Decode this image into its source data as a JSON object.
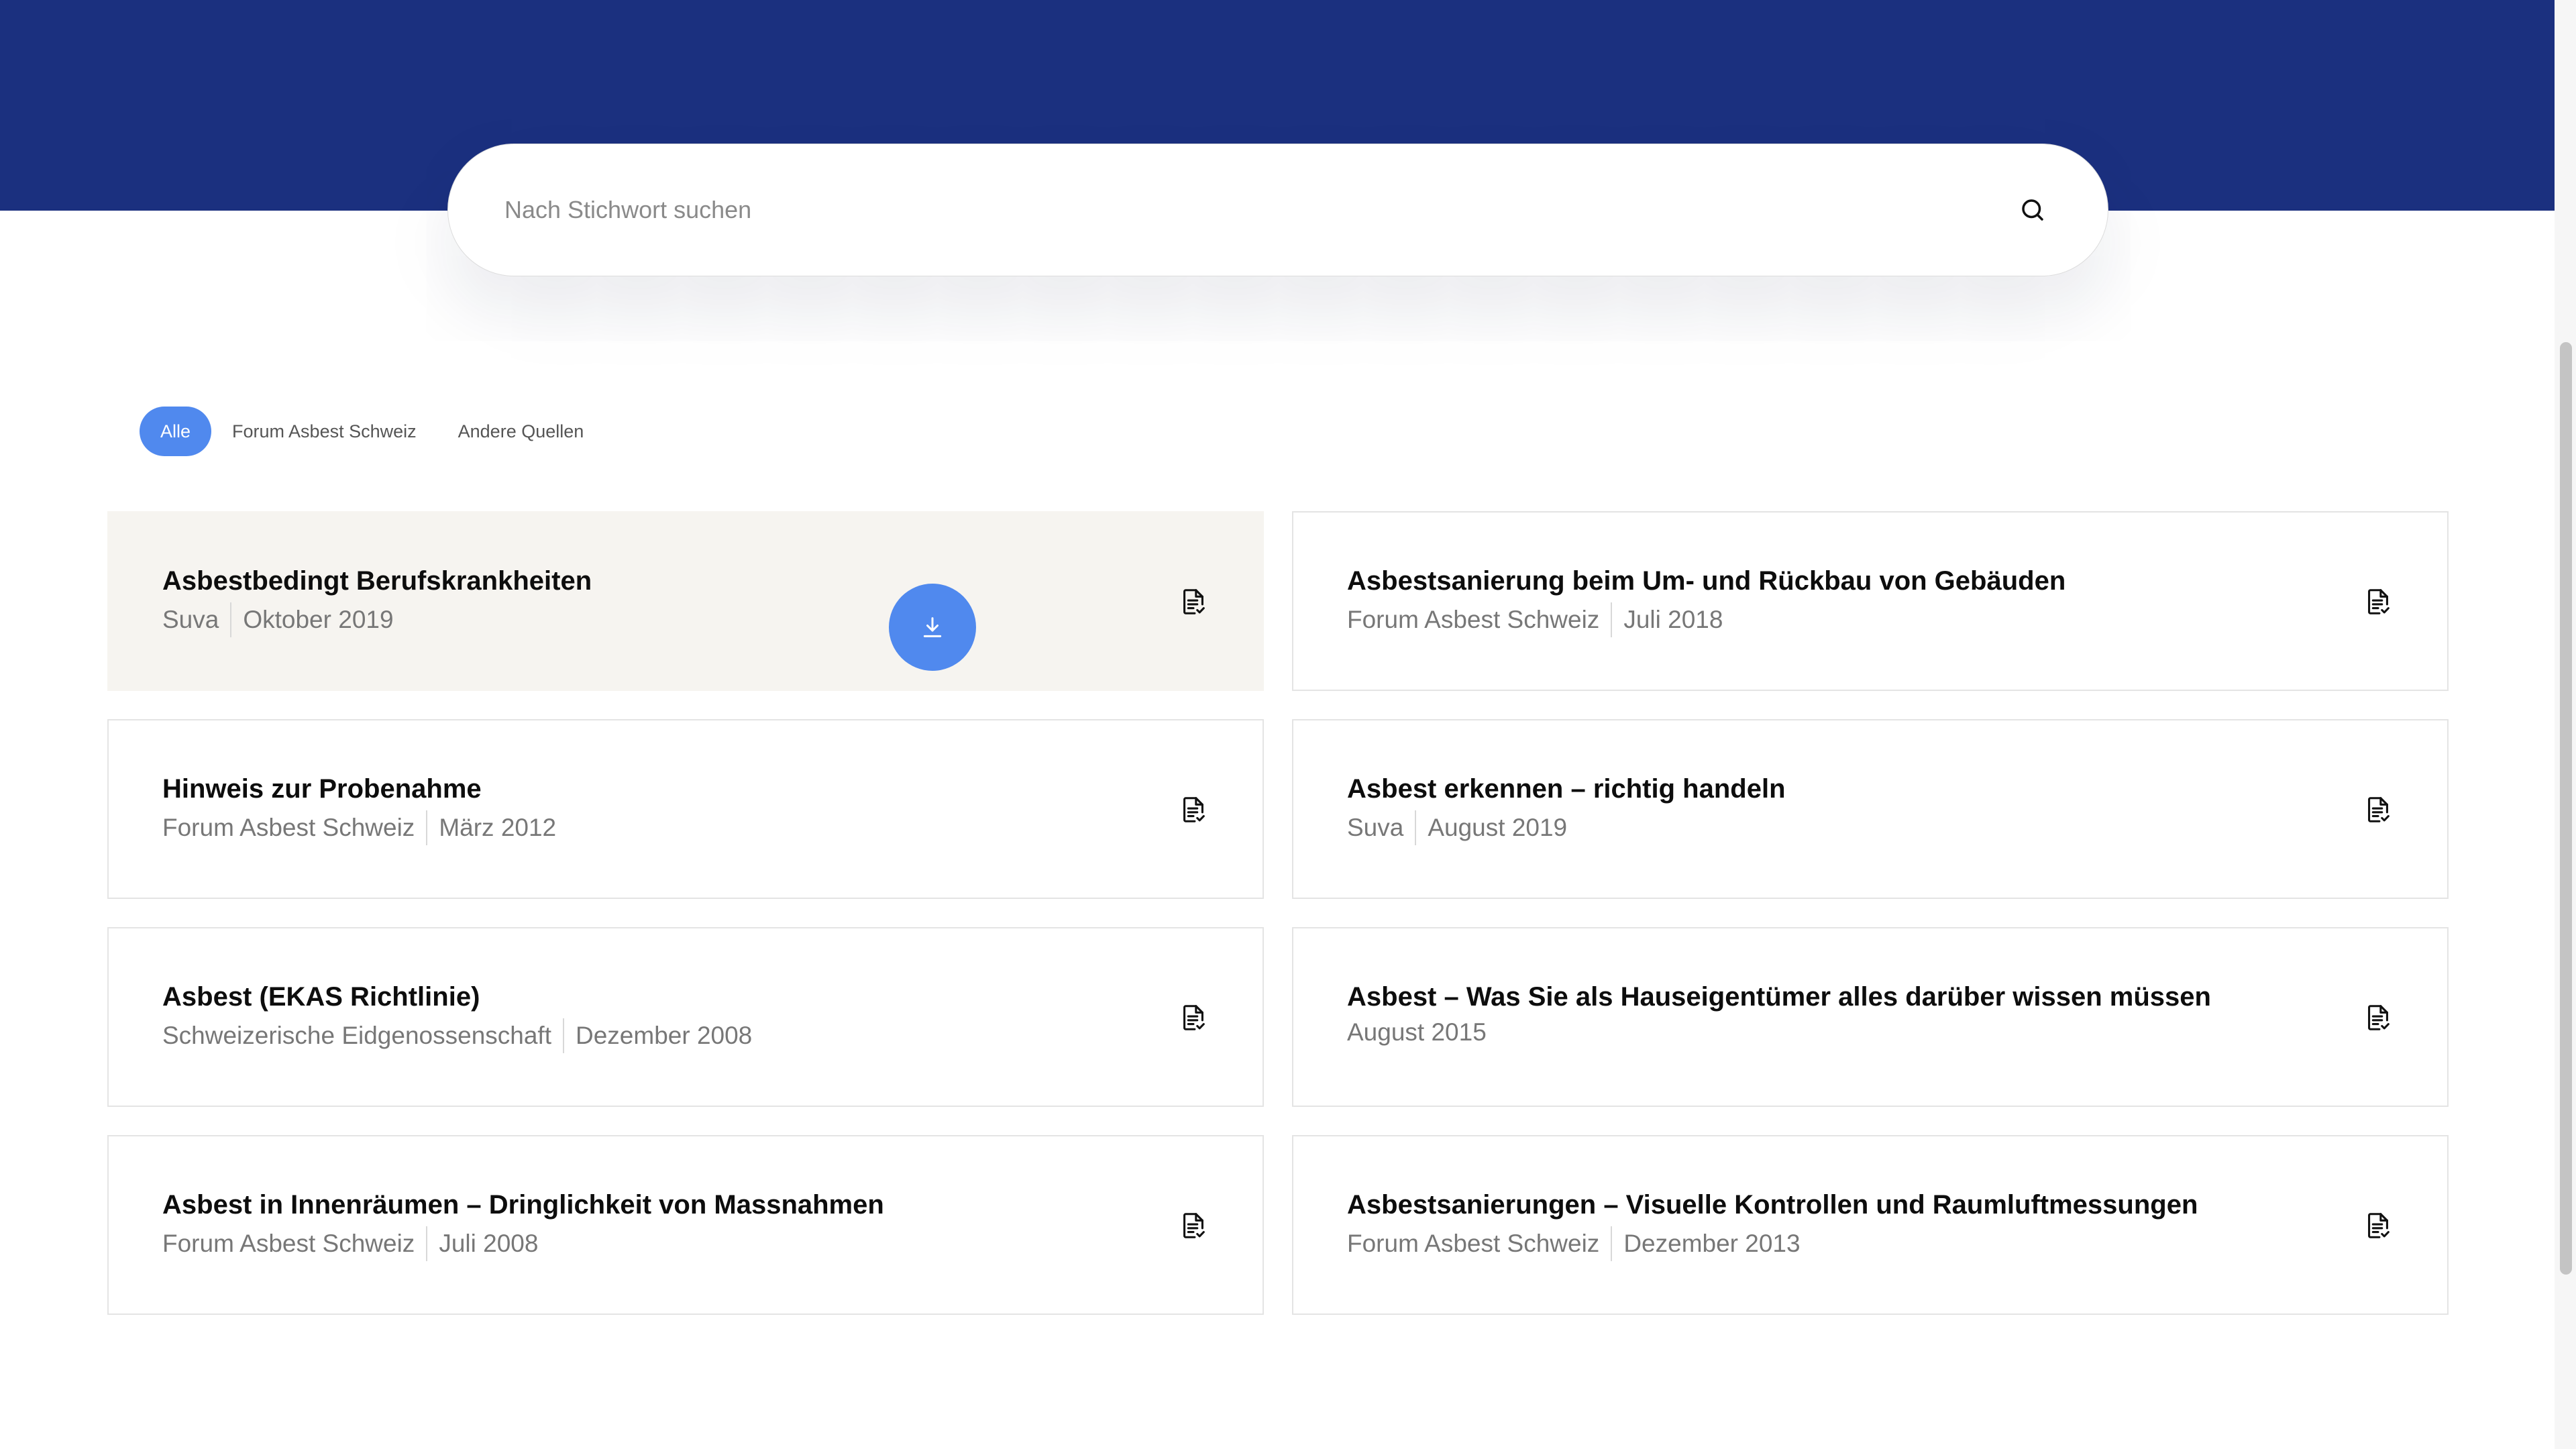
{
  "search": {
    "placeholder": "Nach Stichwort suchen"
  },
  "filters": [
    {
      "label": "Alle",
      "active": true
    },
    {
      "label": "Forum Asbest Schweiz",
      "active": false
    },
    {
      "label": "Andere Quellen",
      "active": false
    }
  ],
  "documents": [
    {
      "title": "Asbestbedingt Berufskrankheiten",
      "source": "Suva",
      "date": "Oktober 2019"
    },
    {
      "title": "Asbestsanierung beim Um- und Rückbau von Gebäuden",
      "source": "Forum Asbest Schweiz",
      "date": "Juli 2018"
    },
    {
      "title": "Hinweis zur Probenahme",
      "source": "Forum Asbest Schweiz",
      "date": "März 2012"
    },
    {
      "title": "Asbest erkennen – richtig handeln",
      "source": "Suva",
      "date": "August 2019"
    },
    {
      "title": "Asbest (EKAS Richtlinie)",
      "source": "Schweizerische Eidgenossenschaft",
      "date": "Dezember 2008"
    },
    {
      "title": "Asbest – Was Sie als Hauseigentümer alles darüber wissen müssen",
      "source": "",
      "date": "August 2015"
    },
    {
      "title": "Asbest in Innenräumen – Dringlichkeit von Massnahmen",
      "source": "Forum Asbest Schweiz",
      "date": "Juli 2008"
    },
    {
      "title": "Asbestsanierungen – Visuelle Kontrollen und Raumluftmessungen",
      "source": "Forum Asbest Schweiz",
      "date": "Dezember 2013"
    }
  ],
  "icons": {
    "search": "search-icon",
    "document": "document-icon",
    "download": "download-icon"
  },
  "colors": {
    "header": "#1b307f",
    "accent": "#5089ee",
    "hover_card": "#f6f4f0"
  }
}
